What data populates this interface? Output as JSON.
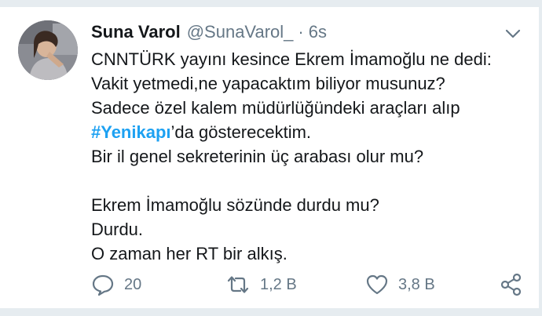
{
  "tweet": {
    "author_name": "Suna Varol",
    "author_handle": "@SunaVarol_",
    "separator": "·",
    "timestamp": "6s",
    "lines": [
      {
        "type": "text",
        "text": "CNNTÜRK yayını kesince Ekrem İmamoğlu ne dedi:"
      },
      {
        "type": "text",
        "text": "Vakit yetmedi,ne yapacaktım biliyor musunuz?"
      },
      {
        "type": "text",
        "text": "Sadece özel kalem müdürlüğündeki araçları alıp"
      },
      {
        "type": "hashtag",
        "hashtag": "#Yenikapı",
        "suffix": "’da gösterecektim."
      },
      {
        "type": "text",
        "text": "Bir il genel sekreterinin üç arabası olur mu?"
      },
      {
        "type": "blank"
      },
      {
        "type": "text",
        "text": "Ekrem İmamoğlu sözünde durdu mu?"
      },
      {
        "type": "text",
        "text": "Durdu."
      },
      {
        "type": "text",
        "text": "O zaman her RT bir alkış."
      }
    ]
  },
  "actions": {
    "reply": {
      "icon": "reply-icon",
      "count": "20"
    },
    "retweet": {
      "icon": "retweet-icon",
      "count": "1,2 B"
    },
    "like": {
      "icon": "heart-icon",
      "count": "3,8 B"
    },
    "share": {
      "icon": "share-icon"
    }
  },
  "colors": {
    "text": "#14171a",
    "secondary": "#657786",
    "hashtag": "#1da1f2",
    "frame": "#e6ecf0"
  }
}
